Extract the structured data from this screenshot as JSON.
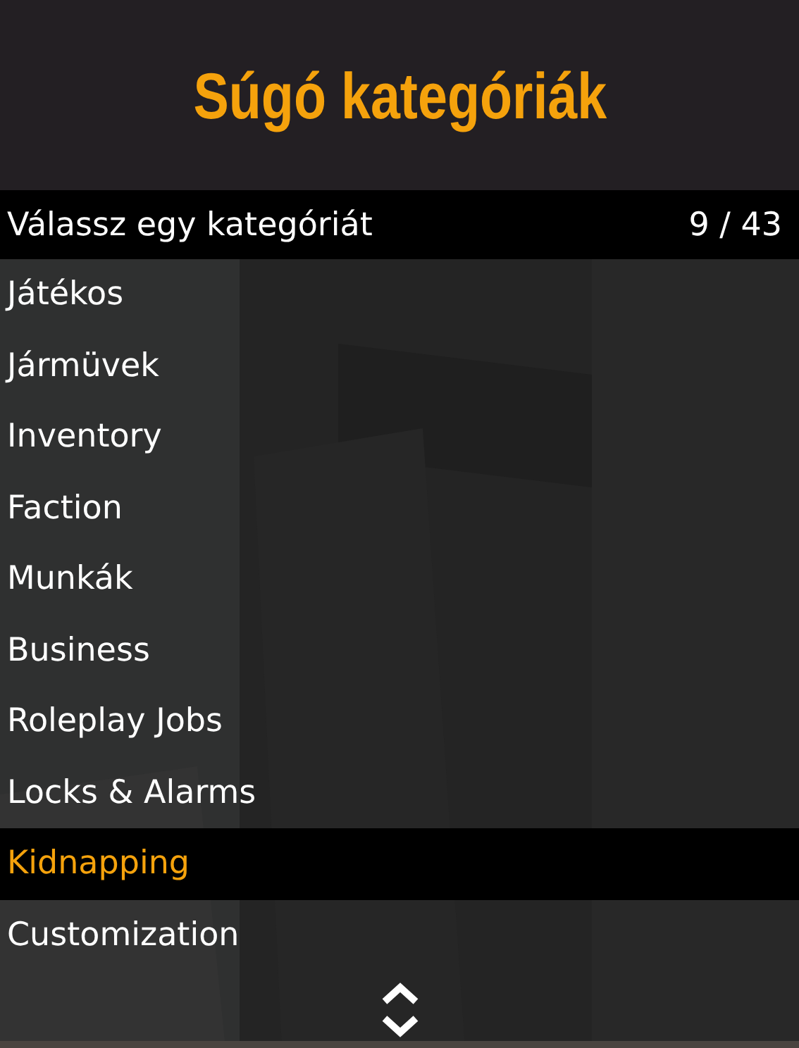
{
  "header": {
    "title": "Súgó kategóriák"
  },
  "subtitle": {
    "label": "Válassz egy kategóriát",
    "counter": "9 / 43"
  },
  "items": [
    {
      "label": "Játékos",
      "selected": false
    },
    {
      "label": "Jármüvek",
      "selected": false
    },
    {
      "label": "Inventory",
      "selected": false
    },
    {
      "label": "Faction",
      "selected": false
    },
    {
      "label": "Munkák",
      "selected": false
    },
    {
      "label": "Business",
      "selected": false
    },
    {
      "label": "Roleplay Jobs",
      "selected": false
    },
    {
      "label": "Locks & Alarms",
      "selected": false
    },
    {
      "label": "Kidnapping",
      "selected": true
    },
    {
      "label": "Customization",
      "selected": false
    }
  ]
}
